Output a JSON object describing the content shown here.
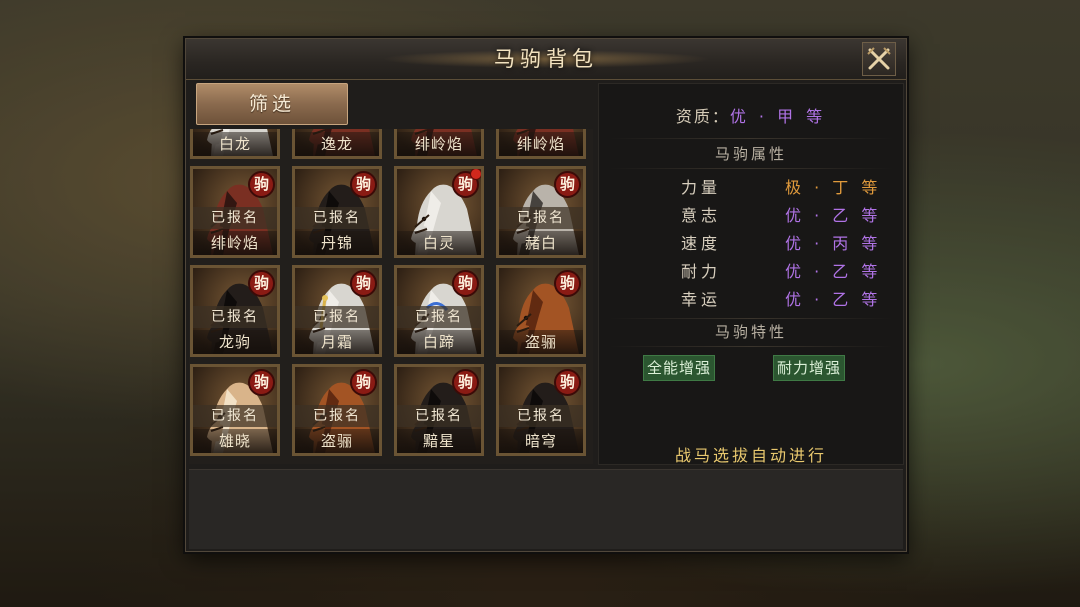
{
  "window": {
    "title": "马驹背包",
    "close_icon": "close-swords-icon"
  },
  "toolbar": {
    "filter_label": "筛选"
  },
  "colors": {
    "brown": "#7a2f22",
    "chestnut": "#a35424",
    "black": "#231d1a",
    "white": "#d8d6d0",
    "grey": "#b9b3aa",
    "palomino": "#d9b48a",
    "purple_grade": "#b073e6",
    "orange_grade": "#e09a3c",
    "trait_green": "#2b5630",
    "footer_gold": "#e8c86e"
  },
  "horses": [
    {
      "name": "白龙",
      "coat": "white",
      "badge": "",
      "status": "",
      "tack": "none"
    },
    {
      "name": "逸龙",
      "coat": "brown",
      "badge": "",
      "status": "",
      "tack": "none"
    },
    {
      "name": "绯岭焰",
      "coat": "brown",
      "badge": "",
      "status": "",
      "tack": "none"
    },
    {
      "name": "绯岭焰",
      "coat": "brown",
      "badge": "",
      "status": "",
      "tack": "none"
    },
    {
      "name": "绯岭焰",
      "coat": "brown",
      "badge": "驹",
      "status": "已报名",
      "tack": "none"
    },
    {
      "name": "丹锦",
      "coat": "black",
      "badge": "驹",
      "status": "已报名",
      "tack": "none"
    },
    {
      "name": "白灵",
      "coat": "white",
      "badge": "驹",
      "status": "",
      "tack": "none",
      "new_dot": true
    },
    {
      "name": "赭白",
      "coat": "grey",
      "badge": "驹",
      "status": "已报名",
      "tack": "none"
    },
    {
      "name": "龙驹",
      "coat": "black",
      "badge": "驹",
      "status": "已报名",
      "tack": "none"
    },
    {
      "name": "月霜",
      "coat": "white",
      "badge": "驹",
      "status": "已报名",
      "tack": "gold"
    },
    {
      "name": "白蹄",
      "coat": "white",
      "badge": "驹",
      "status": "已报名",
      "tack": "blue"
    },
    {
      "name": "盗骊",
      "coat": "chestnut",
      "badge": "驹",
      "status": "",
      "tack": "none"
    },
    {
      "name": "雄晓",
      "coat": "palomino",
      "badge": "驹",
      "status": "已报名",
      "tack": "none"
    },
    {
      "name": "盗骊",
      "coat": "chestnut",
      "badge": "驹",
      "status": "已报名",
      "tack": "none"
    },
    {
      "name": "黯星",
      "coat": "black",
      "badge": "驹",
      "status": "已报名",
      "tack": "none"
    },
    {
      "name": "暗穹",
      "coat": "black",
      "badge": "驹",
      "status": "已报名",
      "tack": "none"
    }
  ],
  "details": {
    "quality_label": "资质：",
    "quality_value": "优 · 甲 等",
    "attributes_title": "马驹属性",
    "attributes": [
      {
        "label": "力量",
        "value": "极 · 丁 等",
        "color": "orange"
      },
      {
        "label": "意志",
        "value": "优 · 乙 等",
        "color": "purple"
      },
      {
        "label": "速度",
        "value": "优 · 丙 等",
        "color": "purple"
      },
      {
        "label": "耐力",
        "value": "优 · 乙 等",
        "color": "purple"
      },
      {
        "label": "幸运",
        "value": "优 · 乙 等",
        "color": "purple"
      }
    ],
    "traits_title": "马驹特性",
    "traits": [
      "全能增强",
      "耐力增强"
    ],
    "footer": "战马选拔自动进行"
  }
}
